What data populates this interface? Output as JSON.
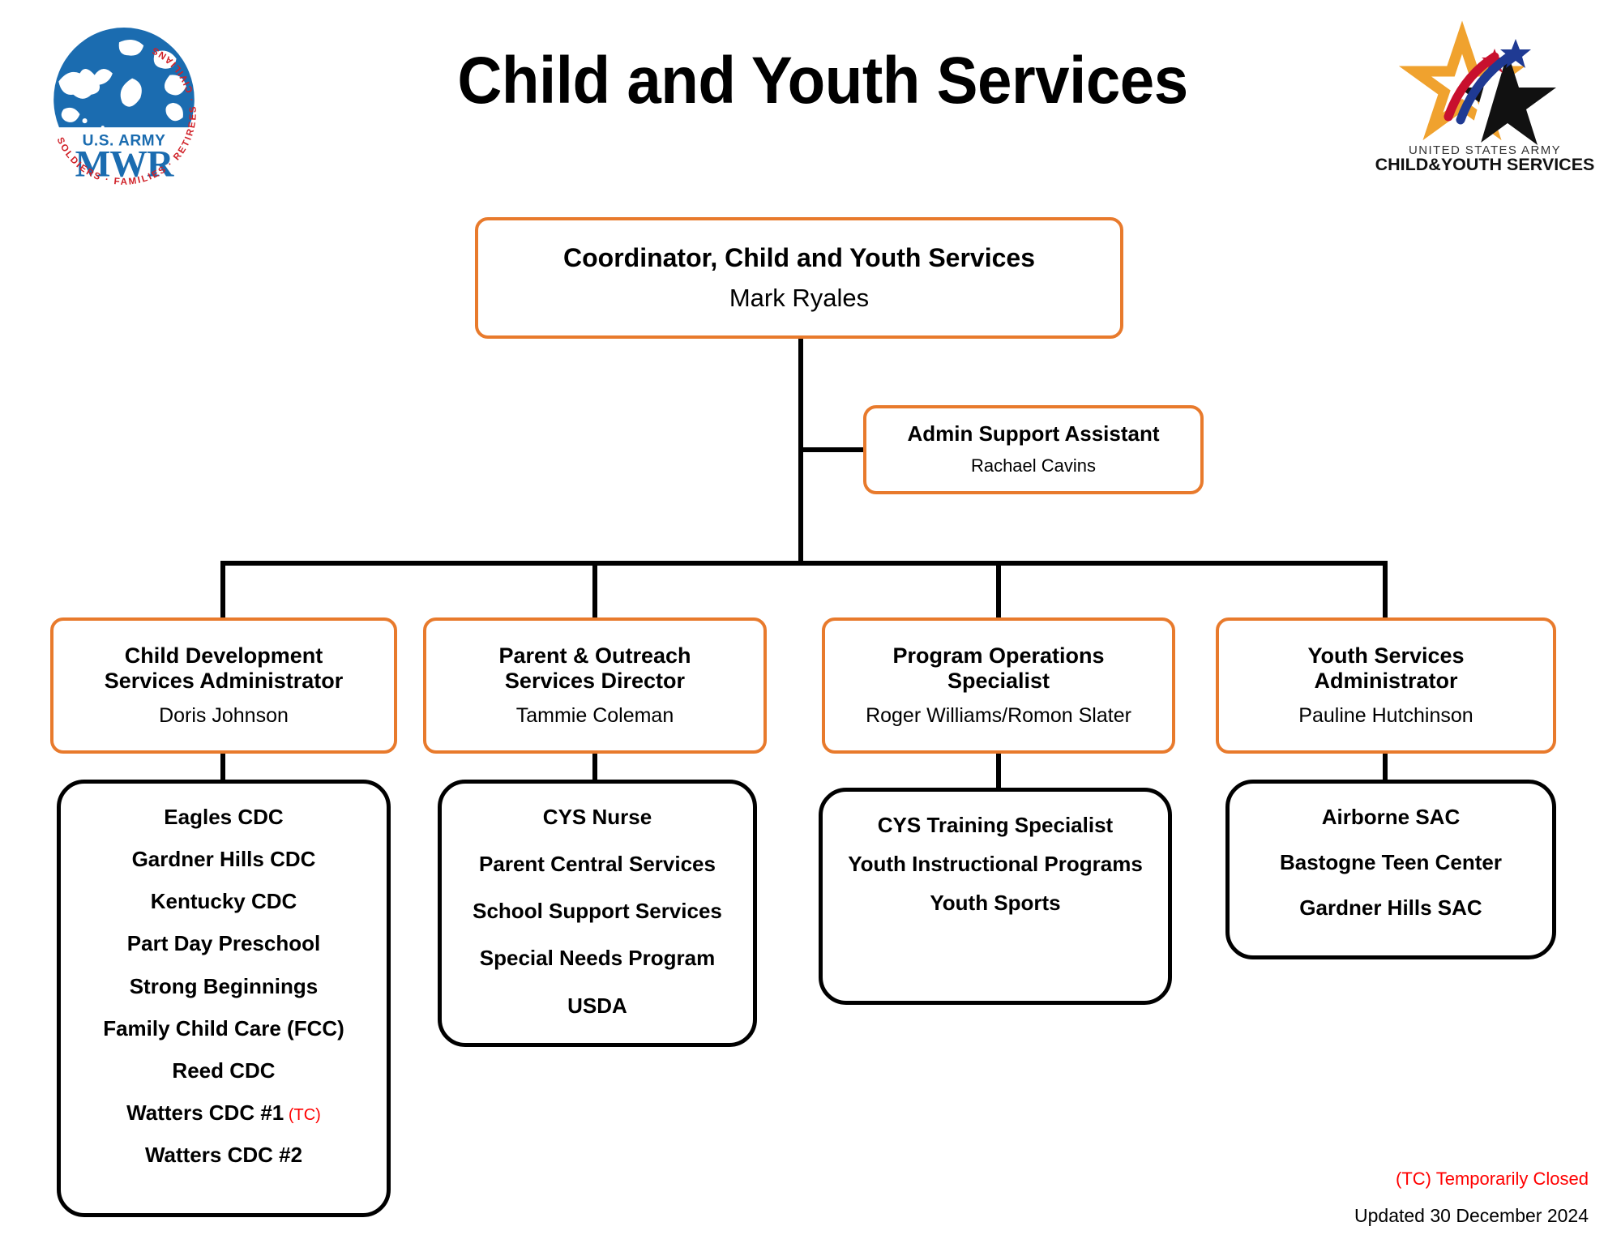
{
  "header": {
    "title": "Child and Youth Services",
    "mwr_logo": {
      "name": "us-army-mwr-logo",
      "line1": "U.S. ARMY",
      "line2": "MWR",
      "ring_text": "SOLDIERS · FAMILIES · RETIREES · CIVILIANS",
      "blue": "#1B6CB0",
      "red": "#D02027"
    },
    "cys_logo": {
      "name": "us-army-child-and-youth-services-logo",
      "line1": "UNITED STATES ARMY",
      "line2": "CHILD&YOUTH SERVICES",
      "gold": "#F0A22E",
      "red": "#C8102E",
      "blue": "#1F3A93",
      "black": "#111111"
    }
  },
  "colors": {
    "orange_border": "#E87A2C",
    "black_border": "#000000",
    "connector": "#000000",
    "tc_red": "#FF0000"
  },
  "org": {
    "coordinator": {
      "title": "Coordinator, Child and Youth Services",
      "person": "Mark Ryales"
    },
    "admin": {
      "title": "Admin Support Assistant",
      "person": "Rachael Cavins"
    },
    "managers": [
      {
        "title_line1": "Child Development",
        "title_line2": "Services Administrator",
        "person": "Doris Johnson",
        "programs": [
          {
            "label": "Eagles CDC",
            "tc": ""
          },
          {
            "label": "Gardner Hills CDC",
            "tc": ""
          },
          {
            "label": "Kentucky CDC",
            "tc": ""
          },
          {
            "label": "Part Day Preschool",
            "tc": ""
          },
          {
            "label": "Strong Beginnings",
            "tc": ""
          },
          {
            "label": "Family Child Care (FCC)",
            "tc": ""
          },
          {
            "label": "Reed CDC",
            "tc": ""
          },
          {
            "label": "Watters CDC #1",
            "tc": "(TC)"
          },
          {
            "label": "Watters CDC #2",
            "tc": ""
          }
        ]
      },
      {
        "title_line1": "Parent & Outreach",
        "title_line2": "Services Director",
        "person": "Tammie Coleman",
        "programs": [
          {
            "label": "CYS Nurse",
            "tc": ""
          },
          {
            "label": "Parent Central Services",
            "tc": ""
          },
          {
            "label": "School Support Services",
            "tc": ""
          },
          {
            "label": "Special Needs Program",
            "tc": ""
          },
          {
            "label": "USDA",
            "tc": ""
          }
        ]
      },
      {
        "title_line1": "Program Operations",
        "title_line2": "Specialist",
        "person": "Roger Williams/Romon Slater",
        "programs": [
          {
            "label": "CYS Training Specialist",
            "tc": ""
          },
          {
            "label": "Youth Instructional Programs",
            "tc": ""
          },
          {
            "label": "Youth Sports",
            "tc": ""
          }
        ]
      },
      {
        "title_line1": "Youth Services",
        "title_line2": "Administrator",
        "person": "Pauline Hutchinson",
        "programs": [
          {
            "label": "Airborne SAC",
            "tc": ""
          },
          {
            "label": "Bastogne Teen Center",
            "tc": ""
          },
          {
            "label": "Gardner Hills SAC",
            "tc": ""
          }
        ]
      }
    ]
  },
  "footer": {
    "legend": "(TC) Temporarily Closed",
    "updated": "Updated 30 December 2024"
  }
}
